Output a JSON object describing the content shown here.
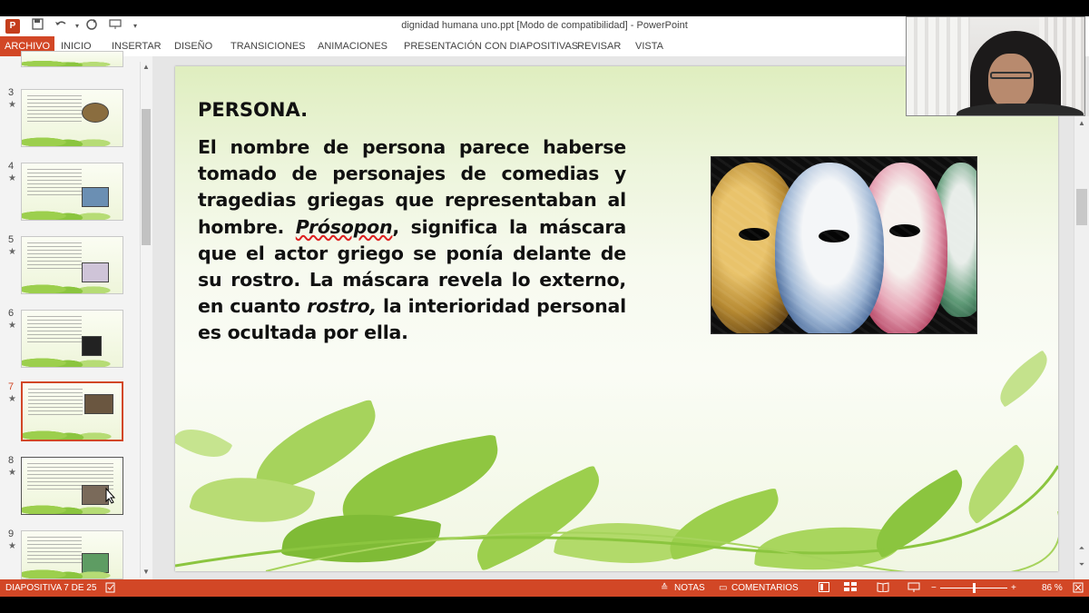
{
  "window": {
    "title": "dignidad humana uno.ppt [Modo de compatibilidad] - PowerPoint",
    "app_icon": "P"
  },
  "quick_access": {
    "save_icon": "save-icon",
    "undo_icon": "undo-icon",
    "redo_icon": "redo-icon",
    "present_icon": "present-icon"
  },
  "ribbon": {
    "tabs": [
      "ARCHIVO",
      "INICIO",
      "INSERTAR",
      "DISEÑO",
      "TRANSICIONES",
      "ANIMACIONES",
      "PRESENTACIÓN CON DIAPOSITIVAS",
      "REVISAR",
      "VISTA"
    ]
  },
  "thumbnails": [
    {
      "num": "3",
      "star": "★"
    },
    {
      "num": "4",
      "star": "★"
    },
    {
      "num": "5",
      "star": "★"
    },
    {
      "num": "6",
      "star": "★"
    },
    {
      "num": "7",
      "star": "★"
    },
    {
      "num": "8",
      "star": "★"
    },
    {
      "num": "9",
      "star": "★"
    }
  ],
  "slide": {
    "title": "PERSONA.",
    "body_pre": "El nombre de persona parece haberse tomado de personajes de comedias y tragedias griegas que representaban al hombre. ",
    "body_italic1": "Prósopon",
    "body_mid": ", significa la máscara que el actor griego se ponía delante de su rostro. La máscara revela lo externo, en cuanto ",
    "body_italic2": "rostro,",
    "body_post": " la interioridad personal es ocultada por ella.",
    "image_alt": "máscaras venecianas"
  },
  "statusbar": {
    "slide_info": "DIAPOSITIVA 7 DE 25",
    "notes": "NOTAS",
    "comments": "COMENTARIOS",
    "zoom": "86 %",
    "zoom_minus": "−",
    "zoom_plus": "+"
  },
  "colors": {
    "accent": "#d24726",
    "leaf_green": "#8bc53f"
  }
}
